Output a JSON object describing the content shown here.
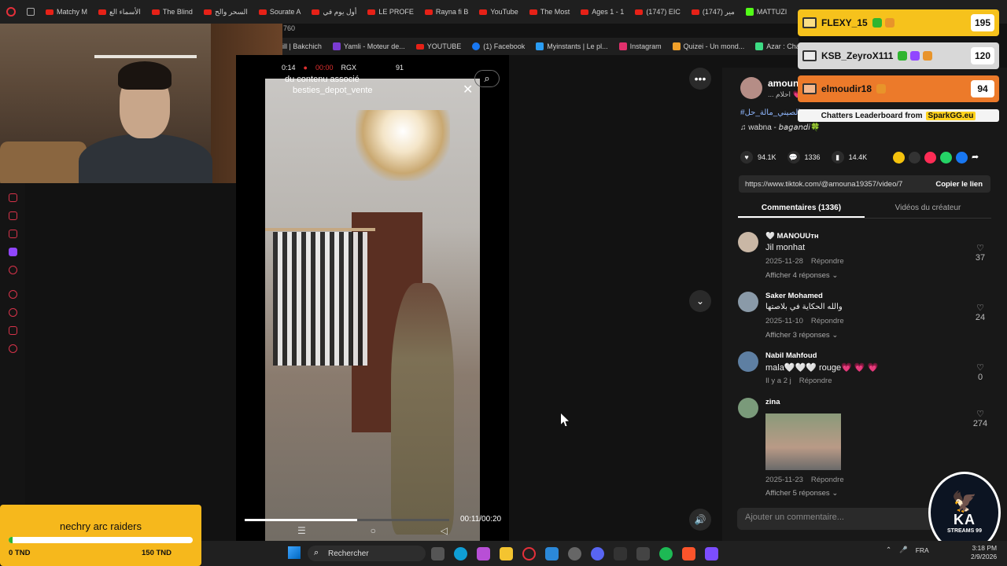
{
  "bookmarks_top": [
    "Matchy M",
    "الأسماء الع",
    "The Blind",
    "السحر والح",
    "Sourate A",
    "أول يوم في",
    "LE PROFE",
    "Rayna fi B",
    "YouTube",
    "The Most",
    "Ages 1 - 1",
    "(1747) EIC",
    "مير (1747)",
    "MATTUZI"
  ],
  "bookmarks_second": [
    "760"
  ],
  "bookmarks_bar2": [
    "ill | Bakchich",
    "Yamli - Moteur de...",
    "YOUTUBE",
    "(1) Facebook",
    "Myinstants | Le pl...",
    "Instagram",
    "Quizei - Un mond...",
    "Azar : Chat Vidéo..."
  ],
  "video": {
    "status_time": "0:14",
    "record_label": "00:00",
    "rgx": "RGX",
    "battery": "91",
    "associated_text": "du contenu associé",
    "account": "besties_depot_vente",
    "progress": 0.55,
    "time": "00:11/00:20"
  },
  "author": {
    "name": "amoun",
    "sub": "... احلام 💗",
    "hashtag": "#الصيني_مالة_حل",
    "music": "wabna - 𝘣𝘢𝘨𝘢𝘯𝘥𝘪🍀"
  },
  "stats": {
    "likes": "94.1K",
    "comments": "1336",
    "saves": "14.4K"
  },
  "link": {
    "url": "https://www.tiktok.com/@amouna19357/video/755...",
    "copy_label": "Copier le lien"
  },
  "tabs": [
    "Commentaires (1336)",
    "Vidéos du créateur"
  ],
  "comments": [
    {
      "name": "🤍 MANOUUᴛʜ",
      "text": "Jil monhat",
      "date": "2025-11-28",
      "reply": "Répondre",
      "more": "Afficher 4 réponses ⌄",
      "likes": "37",
      "avatar": "#c9b7a5"
    },
    {
      "name": "Saker Mohamed",
      "text": "والله الحكاية في بلاصتها",
      "date": "2025-11-10",
      "reply": "Répondre",
      "more": "Afficher 3 réponses ⌄",
      "likes": "24",
      "avatar": "#8a9aa8"
    },
    {
      "name": "Nabil Mahfoud",
      "text": "mala🤍🤍🤍 rouge💗 💗 💗",
      "date": "Il y a 2 j",
      "reply": "Répondre",
      "more": "",
      "likes": "0",
      "avatar": "#5e7fa2"
    },
    {
      "name": "zina",
      "text": "",
      "date": "2025-11-23",
      "reply": "Répondre",
      "more": "Afficher 5 réponses ⌄",
      "likes": "274",
      "avatar": "#7a9a7a"
    }
  ],
  "add_comment_placeholder": "Ajouter un commentaire...",
  "leaderboard": {
    "rows": [
      {
        "name": "FLEXY_15",
        "score": "195",
        "color": "#f6c21c"
      },
      {
        "name": "KSB_ZeyroX111",
        "score": "120",
        "color": "#d8d8d8"
      },
      {
        "name": "elmoudir18",
        "score": "94",
        "color": "#ec7a2a"
      }
    ],
    "footer_text": "Chatters Leaderboard from",
    "footer_brand": "SparkGG.eu"
  },
  "logo": {
    "text": "KA",
    "sub": "STREAMS 99"
  },
  "goal": {
    "title": "nechry arc raiders",
    "progress": 0.02,
    "min": "0 TND",
    "max": "150 TND"
  },
  "taskbar": {
    "search": "Rechercher",
    "lang": "FRA",
    "time": "3:18 PM",
    "date": "2/9/2026"
  }
}
